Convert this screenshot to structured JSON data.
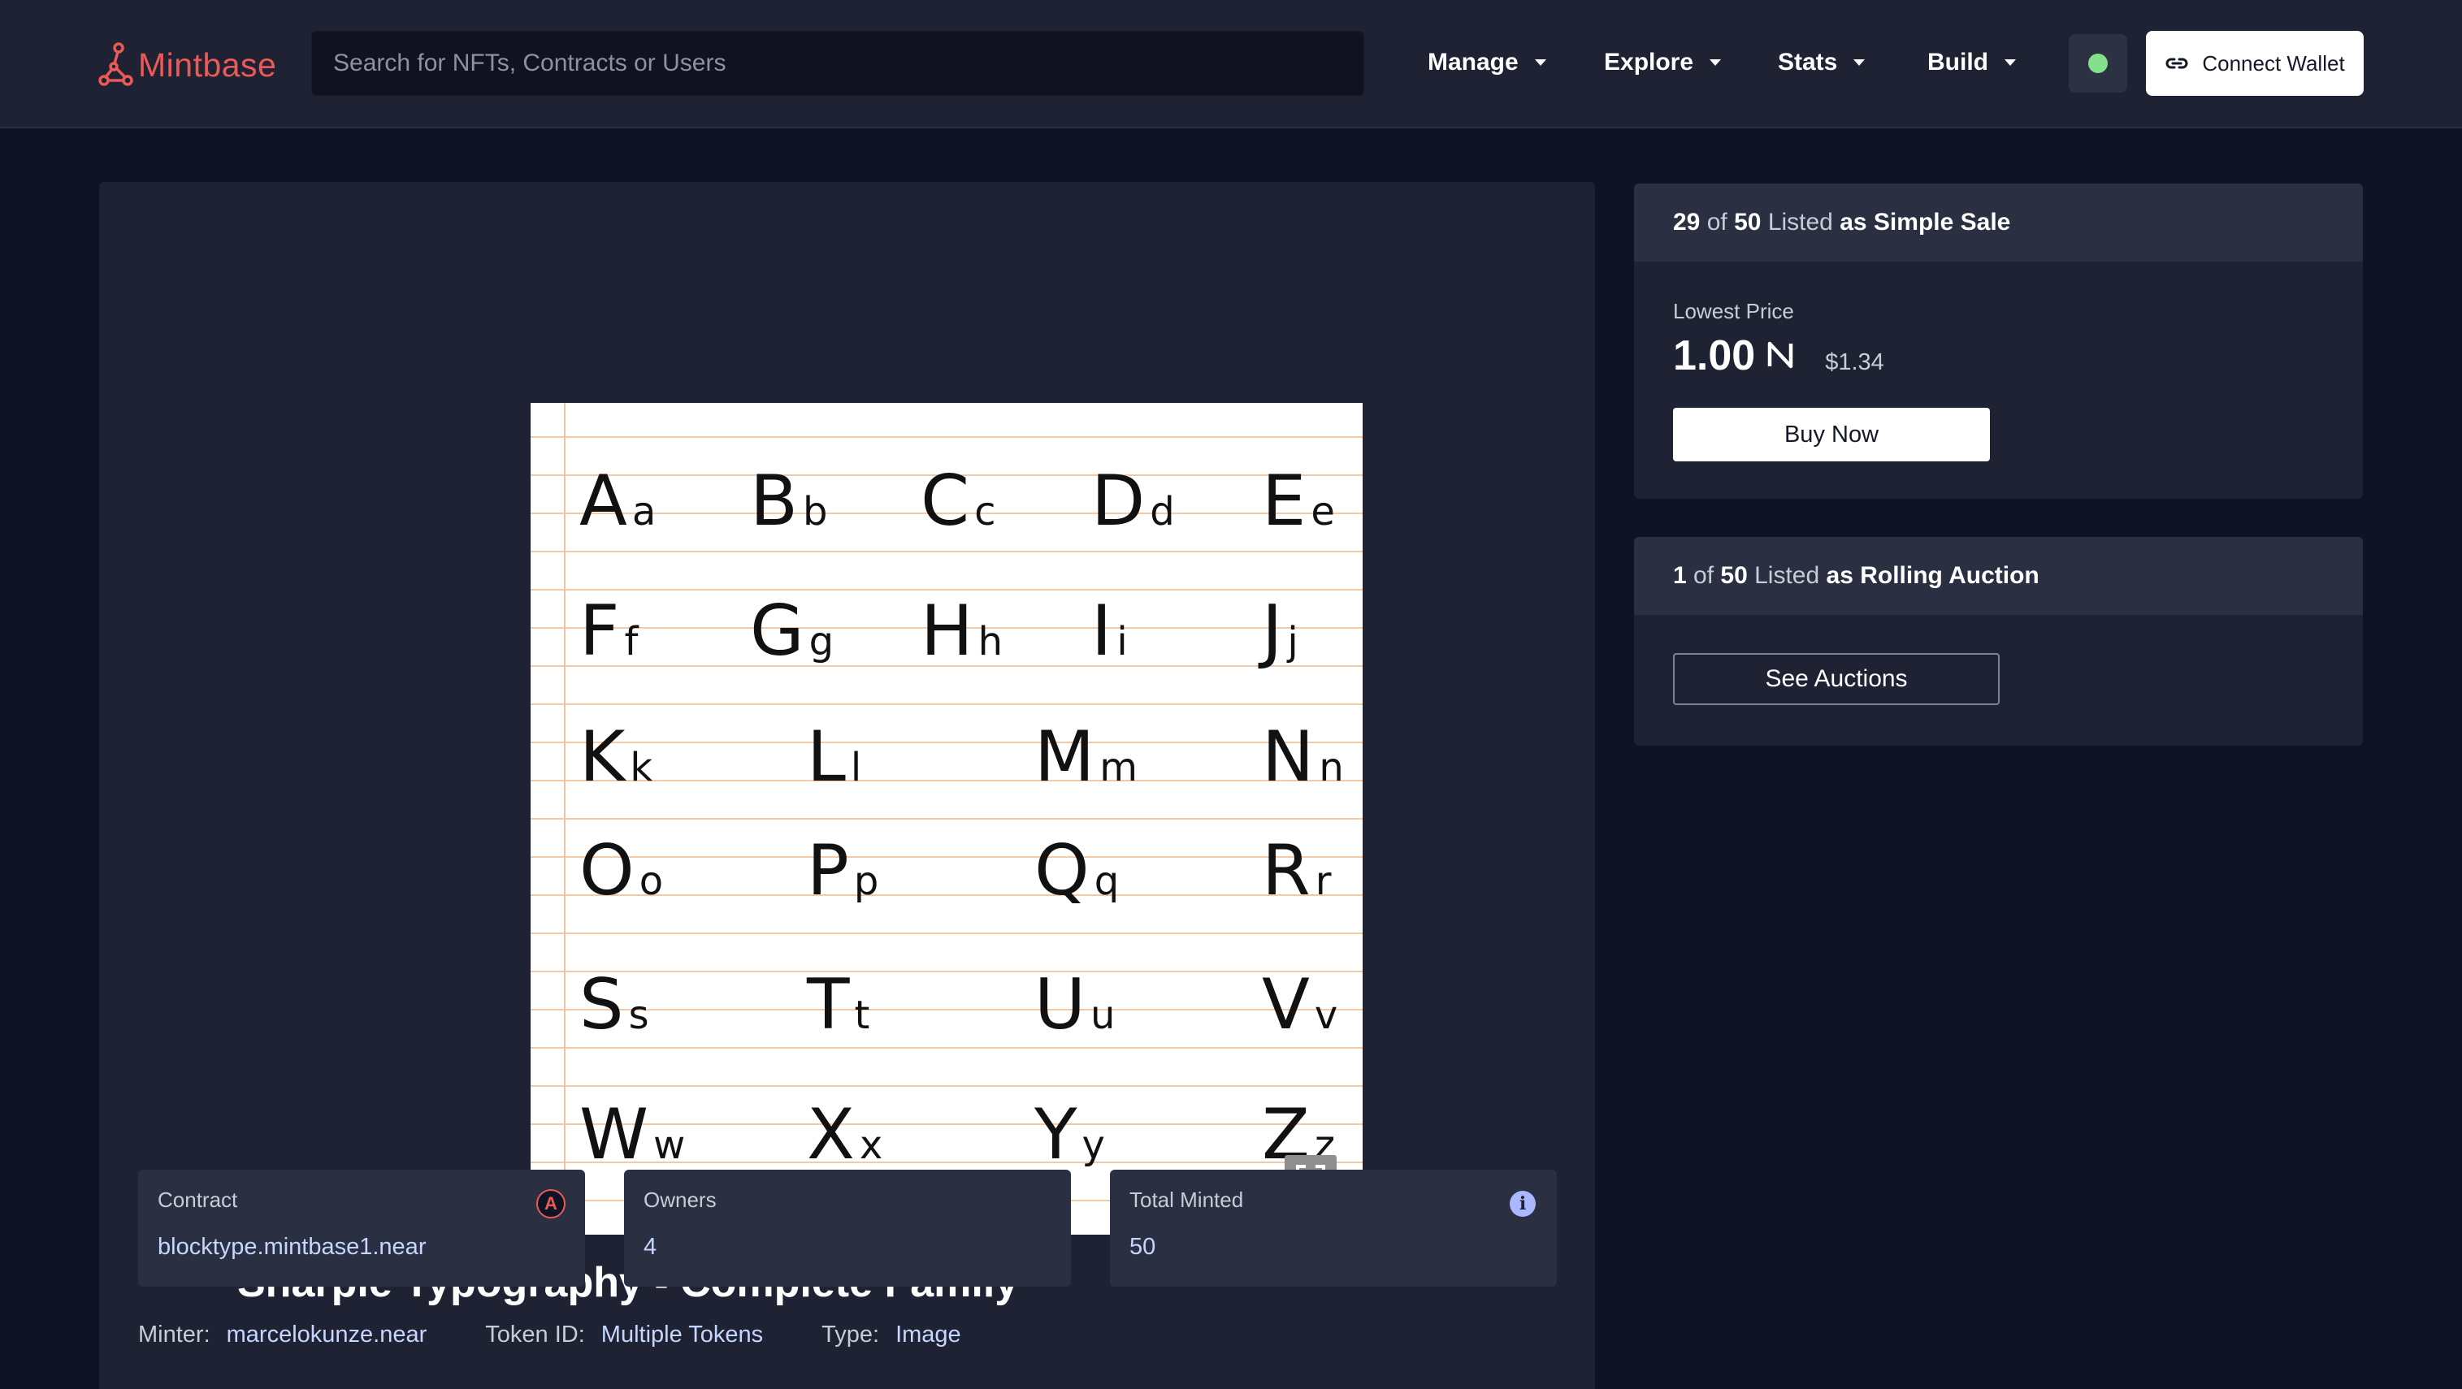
{
  "header": {
    "logo_text": "Mintbase",
    "search_placeholder": "Search for NFTs, Contracts or Users",
    "nav": [
      {
        "label": "Manage"
      },
      {
        "label": "Explore"
      },
      {
        "label": "Stats"
      },
      {
        "label": "Build"
      }
    ],
    "status_color": "#84e08a",
    "connect_label": "Connect Wallet"
  },
  "artwork": {
    "rows": [
      [
        "Aa",
        "Bb",
        "Cc",
        "Dd",
        "Ee"
      ],
      [
        "Ff",
        "Gg",
        "Hh",
        "Ii",
        "Jj"
      ],
      [
        "Kk",
        "Ll",
        "Mm",
        "Nn"
      ],
      [
        "Oo",
        "Pp",
        "Qq",
        "Rr"
      ],
      [
        "Ss",
        "Tt",
        "Uu",
        "Vv"
      ],
      [
        "Ww",
        "Xx",
        "Yy",
        "Zz"
      ]
    ]
  },
  "nft": {
    "title": "Sharpie Typography - Complete Family",
    "cards": {
      "contract_label": "Contract",
      "contract_value": "blocktype.mintbase1.near",
      "owners_label": "Owners",
      "owners_value": "4",
      "minted_label": "Total Minted",
      "minted_value": "50"
    },
    "meta": {
      "minter_label": "Minter:",
      "minter_value": "marcelokunze.near",
      "token_label": "Token ID:",
      "token_value": "Multiple Tokens",
      "type_label": "Type:",
      "type_value": "Image"
    }
  },
  "simple_sale": {
    "listed": "29",
    "of": "of",
    "total": "50",
    "listed_word": "Listed",
    "kind": "as Simple Sale",
    "lowest_price_label": "Lowest Price",
    "price": "1.00",
    "currency_icon": "Ⓝ",
    "usd": "$1.34",
    "buy_label": "Buy Now"
  },
  "auction": {
    "listed": "1",
    "of": "of",
    "total": "50",
    "listed_word": "Listed",
    "kind": "as Rolling Auction",
    "button_label": "See Auctions"
  },
  "colors": {
    "brand": "#ec5a57",
    "background": "#0f1424",
    "panel": "#1e2233",
    "card": "#2a2f41",
    "link_value": "#c7d6ff"
  }
}
